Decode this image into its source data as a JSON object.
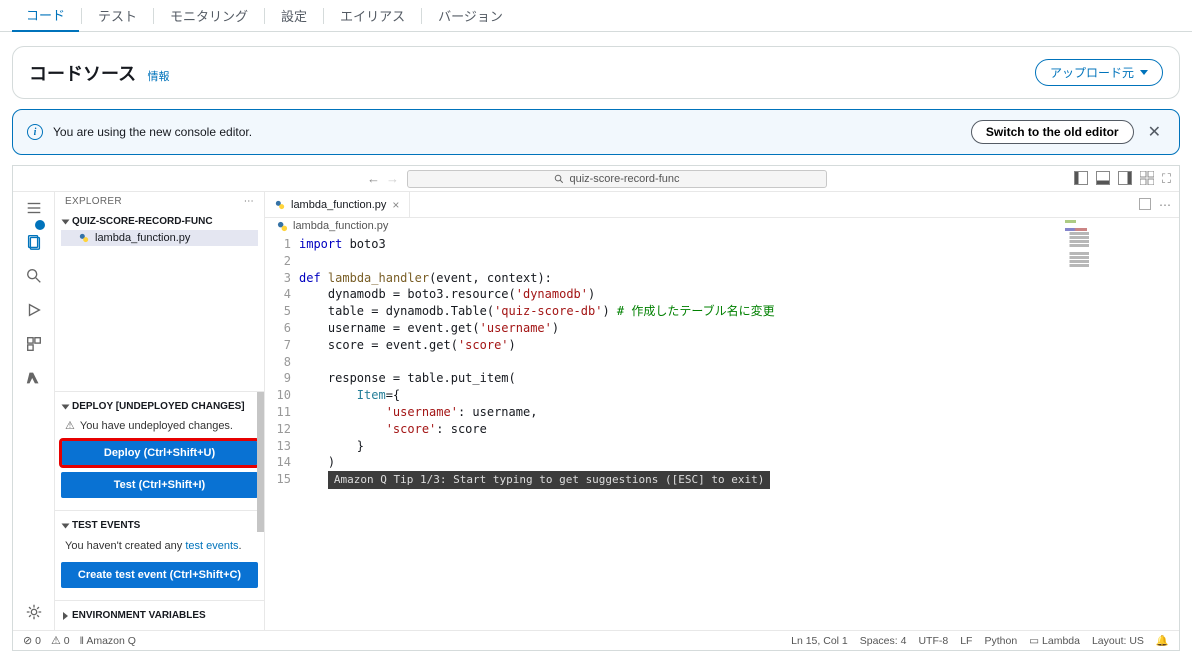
{
  "tabs": {
    "code": "コード",
    "test": "テスト",
    "monitoring": "モニタリング",
    "settings": "設定",
    "alias": "エイリアス",
    "version": "バージョン"
  },
  "panel": {
    "title": "コードソース",
    "info": "情報",
    "upload": "アップロード元"
  },
  "alert": {
    "msg": "You are using the new console editor.",
    "switch": "Switch to the old editor"
  },
  "search_placeholder": "quiz-score-record-func",
  "sidebar": {
    "explorer": "EXPLORER",
    "project": "QUIZ-SCORE-RECORD-FUNC",
    "file": "lambda_function.py",
    "deploy_section": "DEPLOY [UNDEPLOYED CHANGES]",
    "undeployed_msg": "You have undeployed changes.",
    "deploy_btn": "Deploy (Ctrl+Shift+U)",
    "test_btn": "Test (Ctrl+Shift+I)",
    "test_events": "TEST EVENTS",
    "no_test": "You haven't created any ",
    "test_link": "test events",
    "create_test": "Create test event (Ctrl+Shift+C)",
    "env_vars": "ENVIRONMENT VARIABLES"
  },
  "editor": {
    "tab_name": "lambda_function.py",
    "breadcrumb": "lambda_function.py",
    "tip": "Amazon Q Tip 1/3: Start typing to get suggestions ([ESC] to exit)"
  },
  "code_lines": {
    "l1a": "import",
    "l1b": " boto3",
    "l3a": "def",
    "l3b": " ",
    "l3c": "lambda_handler",
    "l3d": "(event, context):",
    "l4a": "    dynamodb = boto3.resource(",
    "l4b": "'dynamodb'",
    "l4c": ")",
    "l5a": "    table = dynamodb.Table(",
    "l5b": "'quiz-score-db'",
    "l5c": ") ",
    "l5d": "# 作成したテーブル名に変更",
    "l6a": "    username = event.get(",
    "l6b": "'username'",
    "l6c": ")",
    "l7a": "    score = event.get(",
    "l7b": "'score'",
    "l7c": ")",
    "l9a": "    response = table.put_item(",
    "l10a": "        ",
    "l10b": "Item",
    "l10c": "={",
    "l11a": "            ",
    "l11b": "'username'",
    "l11c": ": username,",
    "l12a": "            ",
    "l12b": "'score'",
    "l12c": ": score",
    "l13a": "        }",
    "l14a": "    )"
  },
  "gutter": [
    "1",
    "2",
    "3",
    "4",
    "5",
    "6",
    "7",
    "8",
    "9",
    "10",
    "11",
    "12",
    "13",
    "14",
    "15"
  ],
  "status": {
    "errors": "0",
    "warnings": "0",
    "amazonq": "Amazon Q",
    "lncol": "Ln 15, Col 1",
    "spaces": "Spaces: 4",
    "enc": "UTF-8",
    "eol": "LF",
    "lang": "Python",
    "lambda": "Lambda",
    "layout": "Layout: US"
  }
}
